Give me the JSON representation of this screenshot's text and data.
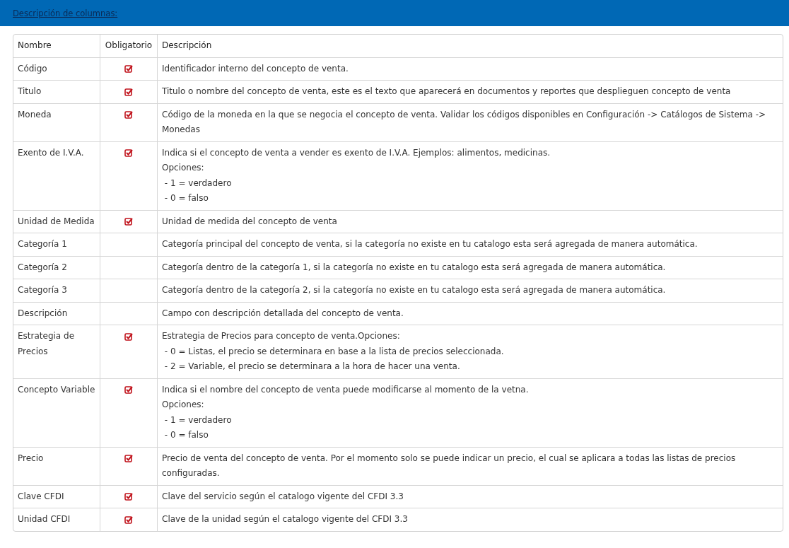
{
  "header": {
    "link": "Descripción de columnas:"
  },
  "table": {
    "columns": [
      "Nombre",
      "Obligatorio",
      "Descripción"
    ],
    "rows": [
      {
        "name": "Código",
        "required": true,
        "description": [
          "Identificador interno del concepto de venta."
        ]
      },
      {
        "name": "Titulo",
        "required": true,
        "description": [
          "Titulo o nombre del concepto de venta, este es el texto que aparecerá en documentos y reportes que desplieguen concepto de venta"
        ]
      },
      {
        "name": "Moneda",
        "required": true,
        "description": [
          "Código de la moneda en la que se negocia el concepto de venta. Validar los códigos disponibles en Configuración -> Catálogos de Sistema -> Monedas"
        ]
      },
      {
        "name": "Exento de I.V.A.",
        "required": true,
        "description": [
          "Indica si el concepto de venta a vender es exento de I.V.A. Ejemplos: alimentos, medicinas.",
          "Opciones:",
          " - 1 = verdadero",
          " - 0 = falso"
        ]
      },
      {
        "name": "Unidad de Medida",
        "required": true,
        "description": [
          "Unidad de medida del concepto de venta"
        ]
      },
      {
        "name": "Categoría 1",
        "required": false,
        "description": [
          "Categoría principal del concepto de venta, si la categoría no existe en tu catalogo esta será agregada de manera automática."
        ]
      },
      {
        "name": "Categoría 2",
        "required": false,
        "description": [
          "Categoría dentro de la categoría 1, si la categoría no existe en tu catalogo esta será agregada de manera automática."
        ]
      },
      {
        "name": "Categoría 3",
        "required": false,
        "description": [
          "Categoría dentro de la categoría 2, si la categoría no existe en tu catalogo esta será agregada de manera automática."
        ]
      },
      {
        "name": "Descripción",
        "required": false,
        "description": [
          "Campo con descripción detallada del concepto de venta."
        ]
      },
      {
        "name": "Estrategia de Precios",
        "required": true,
        "description": [
          "Estrategia de Precios para concepto de venta.Opciones:",
          " - 0 = Listas, el precio se determinara en base a la lista de precios seleccionada.",
          " - 2 = Variable, el precio se determinara a la hora de hacer una venta."
        ]
      },
      {
        "name": "Concepto Variable",
        "required": true,
        "description": [
          "Indica si el nombre del concepto de venta puede modificarse al momento de la vetna.",
          "Opciones:",
          " - 1 = verdadero",
          " - 0 = falso"
        ]
      },
      {
        "name": "Precio",
        "required": true,
        "description": [
          "Precio de venta del concepto de venta. Por el momento solo se puede indicar un precio, el cual se aplicara a todas las listas de precios configuradas."
        ]
      },
      {
        "name": "Clave CFDI",
        "required": true,
        "description": [
          "Clave del servicio según el catalogo vigente del CFDI 3.3"
        ]
      },
      {
        "name": "Unidad CFDI",
        "required": true,
        "description": [
          "Clave de la unidad según el catalogo vigente del CFDI 3.3"
        ]
      }
    ]
  }
}
